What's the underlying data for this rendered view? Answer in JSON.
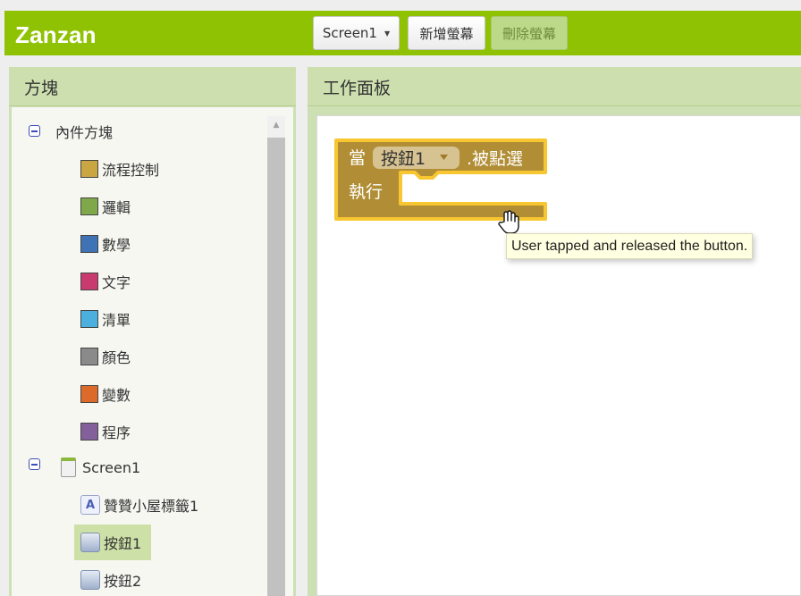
{
  "app": {
    "title": "Zanzan"
  },
  "toolbar": {
    "screen_select": "Screen1",
    "add_screen": "新增螢幕",
    "remove_screen": "刪除螢幕"
  },
  "blocks_panel": {
    "title": "方塊",
    "builtin": {
      "label": "內件方塊",
      "items": [
        {
          "label": "流程控制",
          "color": "#c9a642"
        },
        {
          "label": "邏輯",
          "color": "#7ea84a"
        },
        {
          "label": "數學",
          "color": "#3f73b5"
        },
        {
          "label": "文字",
          "color": "#c93a6e"
        },
        {
          "label": "清單",
          "color": "#4bb0de"
        },
        {
          "label": "顏色",
          "color": "#8a8a8a"
        },
        {
          "label": "變數",
          "color": "#dc6a2a"
        },
        {
          "label": "程序",
          "color": "#84609a"
        }
      ]
    },
    "screen": {
      "label": "Screen1",
      "components": [
        {
          "label": "贊贊小屋標籤1",
          "icon": "label-icon",
          "glyph": "A"
        },
        {
          "label": "按鈕1",
          "icon": "button-icon",
          "selected": true
        },
        {
          "label": "按鈕2",
          "icon": "button-icon"
        }
      ]
    }
  },
  "workspace": {
    "title": "工作面板",
    "event_block": {
      "when": "當",
      "component": "按鈕1",
      "event": ".被點選",
      "do": "執行",
      "color": "#b18e35",
      "highlight": "#f8c631"
    },
    "tooltip": "User tapped and released the button."
  }
}
